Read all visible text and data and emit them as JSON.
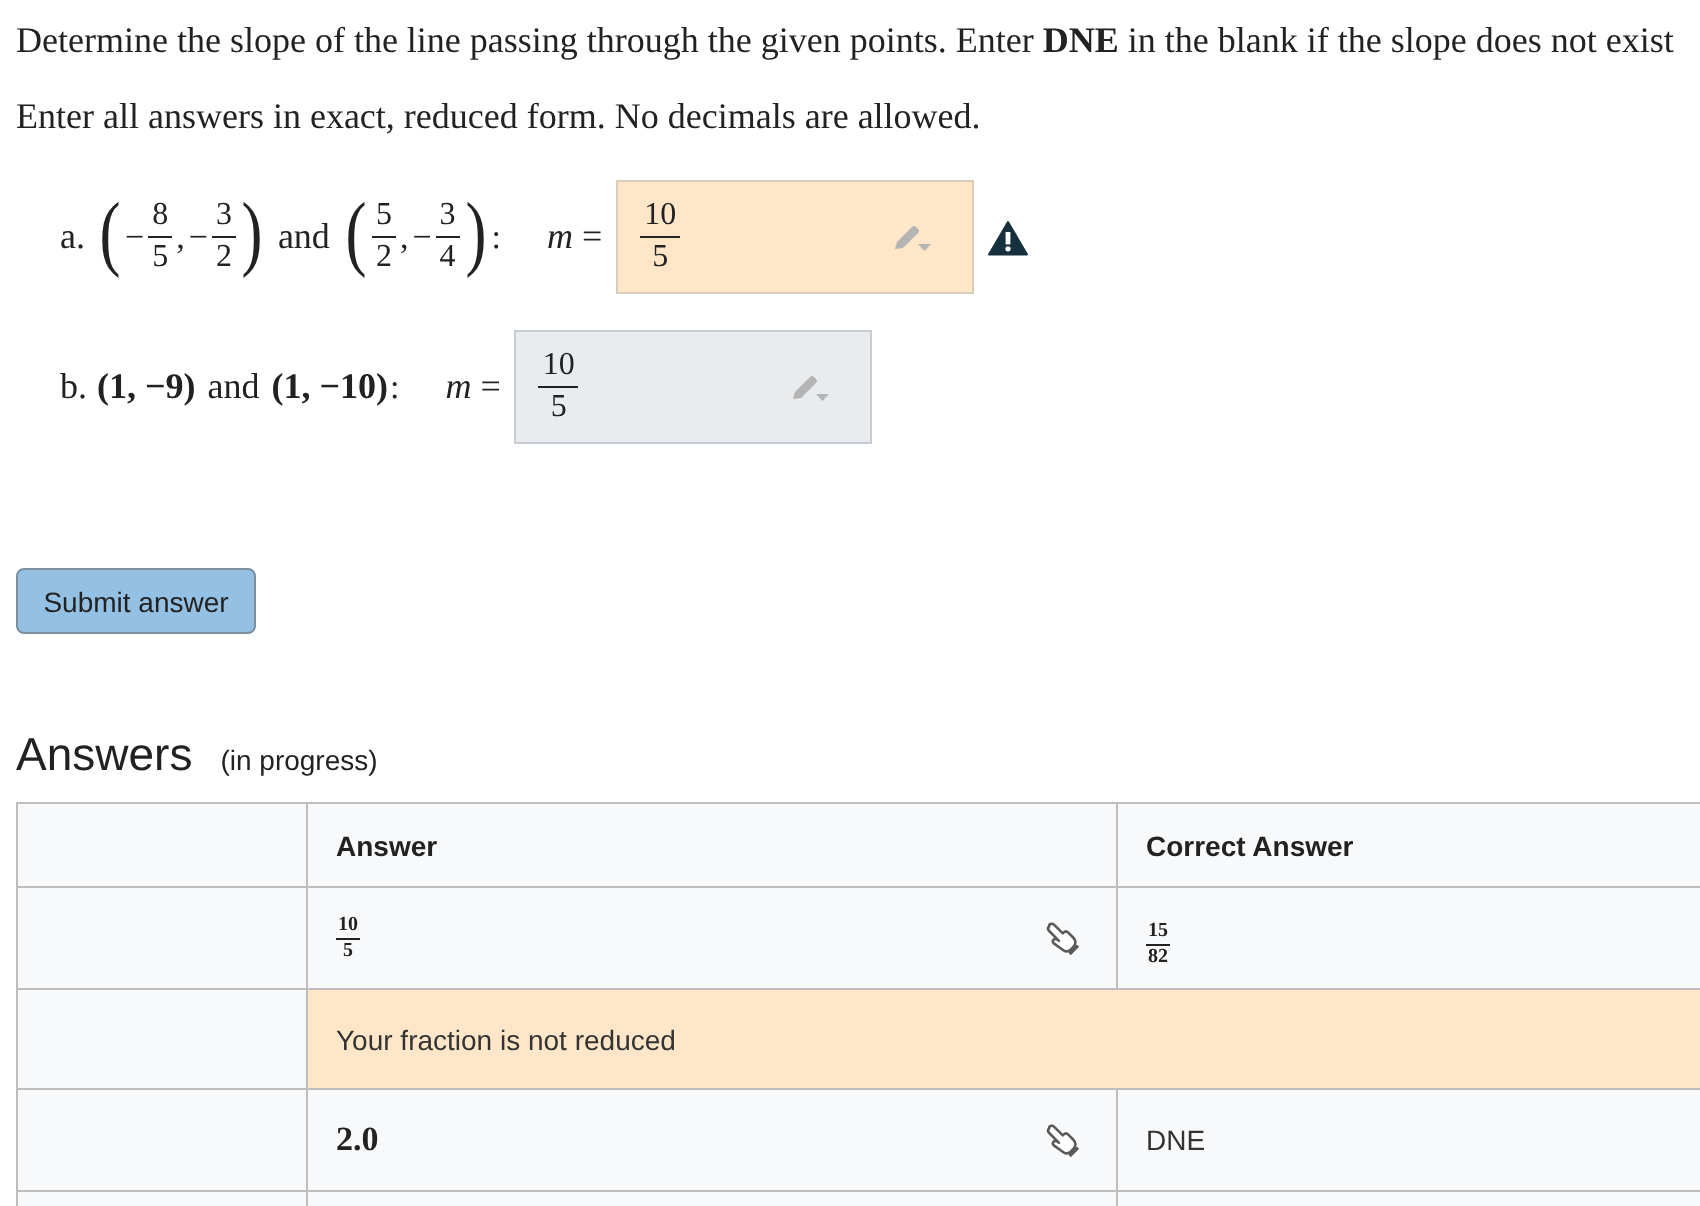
{
  "instructions": [
    "Determine the slope of the line passing through the given points. Enter **DNE** in the blank if the slope does not exist",
    "Enter all answers in exact, reduced form. No decimals are allowed."
  ],
  "problems": [
    {
      "label": "a.",
      "expression": [
        {
          "kind": "paren",
          "text": "("
        },
        {
          "kind": "math",
          "text": "−"
        },
        {
          "kind": "frac",
          "num": "8",
          "den": "5"
        },
        {
          "kind": "math",
          "text": ","
        },
        {
          "kind": "math",
          "text": "−"
        },
        {
          "kind": "frac",
          "num": "3",
          "den": "2"
        },
        {
          "kind": "paren",
          "text": ")"
        },
        {
          "kind": "text",
          "text": "and"
        },
        {
          "kind": "paren",
          "text": "("
        },
        {
          "kind": "frac",
          "num": "5",
          "den": "2"
        },
        {
          "kind": "math",
          "text": ","
        },
        {
          "kind": "math",
          "text": "−"
        },
        {
          "kind": "frac",
          "num": "3",
          "den": "4"
        },
        {
          "kind": "paren",
          "text": ")"
        },
        {
          "kind": "math",
          "text": ":"
        }
      ],
      "variable": "*m* =",
      "answer": {
        "num": "10",
        "den": "5"
      },
      "warning": true
    },
    {
      "label": "b.",
      "expression": [
        {
          "kind": "bold",
          "text": "(1, −9)"
        },
        {
          "kind": "text",
          "text": "and"
        },
        {
          "kind": "bold",
          "text": "(1, −10)"
        },
        {
          "kind": "math",
          "text": ":"
        }
      ],
      "variable": "*m* =",
      "answer": {
        "num": "10",
        "den": "5"
      },
      "warning": false
    }
  ],
  "submit_button": "Submit answer",
  "answers": {
    "title": "Answers",
    "status": "(in progress)",
    "columns": [
      "Answer",
      "Correct Answer"
    ],
    "rows": [
      {
        "answer": {
          "kind": "frac",
          "num": "10",
          "den": "5"
        },
        "correct": {
          "kind": "frac",
          "num": "15",
          "den": "82"
        },
        "feedback": "Your fraction is not reduced"
      },
      {
        "answer": {
          "kind": "math",
          "text": "2.0"
        },
        "correct": {
          "kind": "text",
          "text": "DNE"
        }
      }
    ]
  }
}
